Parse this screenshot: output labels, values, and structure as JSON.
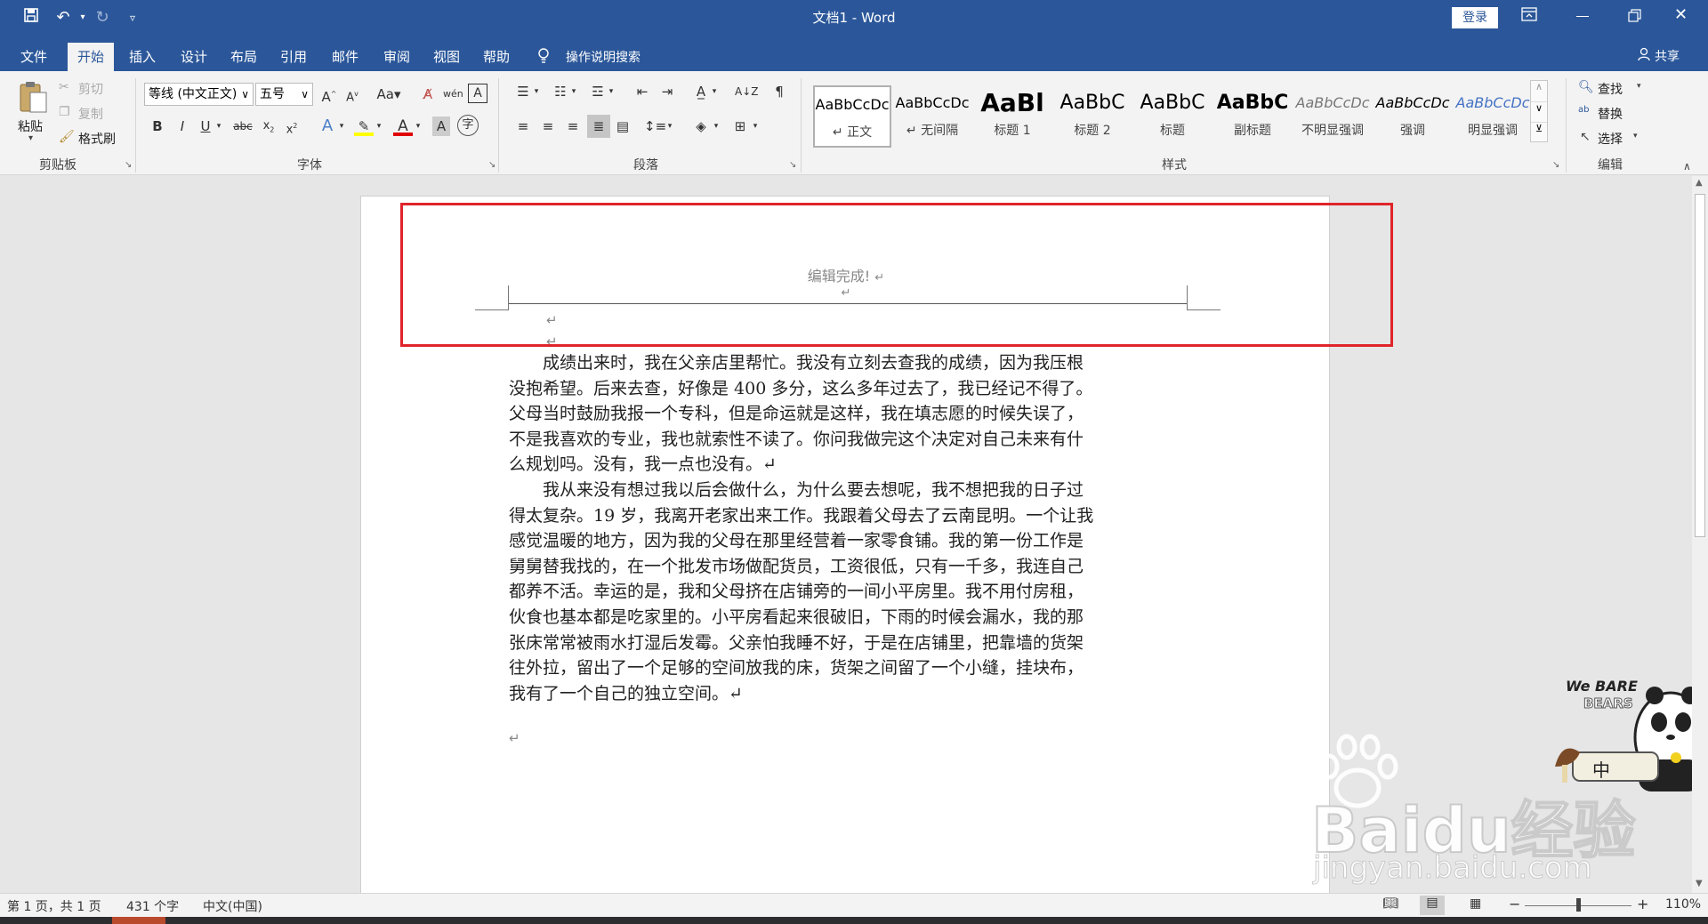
{
  "window": {
    "title": "文档1 - Word",
    "login_label": "登录"
  },
  "tabs": [
    "文件",
    "开始",
    "插入",
    "设计",
    "布局",
    "引用",
    "邮件",
    "审阅",
    "视图",
    "帮助"
  ],
  "tell_me": "操作说明搜索",
  "share": "共享",
  "clipboard": {
    "paste": "粘贴",
    "cut": "剪切",
    "copy": "复制",
    "format_painter": "格式刷",
    "group": "剪贴板"
  },
  "font": {
    "name": "等线 (中文正文)",
    "size": "五号",
    "group": "字体"
  },
  "paragraph": {
    "group": "段落"
  },
  "styles": {
    "group": "样式",
    "items": [
      {
        "preview": "AaBbCcDc",
        "name": "正文"
      },
      {
        "preview": "AaBbCcDc",
        "name": "无间隔"
      },
      {
        "preview": "AaBl",
        "name": "标题 1"
      },
      {
        "preview": "AaBbC",
        "name": "标题 2"
      },
      {
        "preview": "AaBbC",
        "name": "标题"
      },
      {
        "preview": "AaBbC",
        "name": "副标题"
      },
      {
        "preview": "AaBbCcDc",
        "name": "不明显强调"
      },
      {
        "preview": "AaBbCcDc",
        "name": "强调"
      },
      {
        "preview": "AaBbCcDc",
        "name": "明显强调"
      }
    ]
  },
  "editing": {
    "find": "查找",
    "replace": "替换",
    "select": "选择",
    "group": "编辑"
  },
  "document": {
    "header_text": "编辑完成!",
    "para_mark": "↵",
    "paragraph1_lines": [
      "　　成绩出来时，我在父亲店里帮忙。我没有立刻去查我的成绩，因为我压根",
      "没抱希望。后来去查，好像是 400 多分，这么多年过去了，我已经记不得了。",
      "父母当时鼓励我报一个专科，但是命运就是这样，我在填志愿的时候失误了，",
      "不是我喜欢的专业，我也就索性不读了。你问我做完这个决定对自己未来有什",
      "么规划吗。没有，我一点也没有。↵"
    ],
    "paragraph2_lines": [
      "　　我从来没有想过我以后会做什么，为什么要去想呢，我不想把我的日子过",
      "得太复杂。19 岁，我离开老家出来工作。我跟着父母去了云南昆明。一个让我",
      "感觉温暖的地方，因为我的父母在那里经营着一家零食铺。我的第一份工作是",
      "舅舅替我找的，在一个批发市场做配货员，工资很低，只有一千多，我连自己",
      "都养不活。幸运的是，我和父母挤在店铺旁的一间小平房里。我不用付房租，",
      "伙食也基本都是吃家里的。小平房看起来很破旧，下雨的时候会漏水，我的那",
      "张床常常被雨水打湿后发霉。父亲怕我睡不好，于是在店铺里，把靠墙的货架",
      "往外拉，留出了一个足够的空间放我的床，货架之间留了一个小缝，挂块布，",
      "我有了一个自己的独立空间。↵"
    ]
  },
  "status": {
    "page": "第 1 页，共 1 页",
    "words": "431 个字",
    "lang": "中文(中国)",
    "zoom": "110%"
  },
  "watermark": {
    "baidu": "Baidu经验",
    "url": "jingyan.baidu.com",
    "bears_line1": "We BARE",
    "bears_line2": "BEARS",
    "bears_cn": "中"
  }
}
